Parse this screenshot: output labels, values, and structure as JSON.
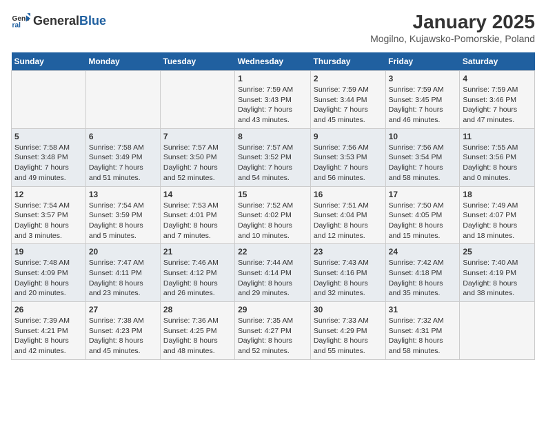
{
  "logo": {
    "text_general": "General",
    "text_blue": "Blue"
  },
  "title": "January 2025",
  "subtitle": "Mogilno, Kujawsko-Pomorskie, Poland",
  "days_of_week": [
    "Sunday",
    "Monday",
    "Tuesday",
    "Wednesday",
    "Thursday",
    "Friday",
    "Saturday"
  ],
  "weeks": [
    [
      {
        "day": "",
        "info": ""
      },
      {
        "day": "",
        "info": ""
      },
      {
        "day": "",
        "info": ""
      },
      {
        "day": "1",
        "info": "Sunrise: 7:59 AM\nSunset: 3:43 PM\nDaylight: 7 hours\nand 43 minutes."
      },
      {
        "day": "2",
        "info": "Sunrise: 7:59 AM\nSunset: 3:44 PM\nDaylight: 7 hours\nand 45 minutes."
      },
      {
        "day": "3",
        "info": "Sunrise: 7:59 AM\nSunset: 3:45 PM\nDaylight: 7 hours\nand 46 minutes."
      },
      {
        "day": "4",
        "info": "Sunrise: 7:59 AM\nSunset: 3:46 PM\nDaylight: 7 hours\nand 47 minutes."
      }
    ],
    [
      {
        "day": "5",
        "info": "Sunrise: 7:58 AM\nSunset: 3:48 PM\nDaylight: 7 hours\nand 49 minutes."
      },
      {
        "day": "6",
        "info": "Sunrise: 7:58 AM\nSunset: 3:49 PM\nDaylight: 7 hours\nand 51 minutes."
      },
      {
        "day": "7",
        "info": "Sunrise: 7:57 AM\nSunset: 3:50 PM\nDaylight: 7 hours\nand 52 minutes."
      },
      {
        "day": "8",
        "info": "Sunrise: 7:57 AM\nSunset: 3:52 PM\nDaylight: 7 hours\nand 54 minutes."
      },
      {
        "day": "9",
        "info": "Sunrise: 7:56 AM\nSunset: 3:53 PM\nDaylight: 7 hours\nand 56 minutes."
      },
      {
        "day": "10",
        "info": "Sunrise: 7:56 AM\nSunset: 3:54 PM\nDaylight: 7 hours\nand 58 minutes."
      },
      {
        "day": "11",
        "info": "Sunrise: 7:55 AM\nSunset: 3:56 PM\nDaylight: 8 hours\nand 0 minutes."
      }
    ],
    [
      {
        "day": "12",
        "info": "Sunrise: 7:54 AM\nSunset: 3:57 PM\nDaylight: 8 hours\nand 3 minutes."
      },
      {
        "day": "13",
        "info": "Sunrise: 7:54 AM\nSunset: 3:59 PM\nDaylight: 8 hours\nand 5 minutes."
      },
      {
        "day": "14",
        "info": "Sunrise: 7:53 AM\nSunset: 4:01 PM\nDaylight: 8 hours\nand 7 minutes."
      },
      {
        "day": "15",
        "info": "Sunrise: 7:52 AM\nSunset: 4:02 PM\nDaylight: 8 hours\nand 10 minutes."
      },
      {
        "day": "16",
        "info": "Sunrise: 7:51 AM\nSunset: 4:04 PM\nDaylight: 8 hours\nand 12 minutes."
      },
      {
        "day": "17",
        "info": "Sunrise: 7:50 AM\nSunset: 4:05 PM\nDaylight: 8 hours\nand 15 minutes."
      },
      {
        "day": "18",
        "info": "Sunrise: 7:49 AM\nSunset: 4:07 PM\nDaylight: 8 hours\nand 18 minutes."
      }
    ],
    [
      {
        "day": "19",
        "info": "Sunrise: 7:48 AM\nSunset: 4:09 PM\nDaylight: 8 hours\nand 20 minutes."
      },
      {
        "day": "20",
        "info": "Sunrise: 7:47 AM\nSunset: 4:11 PM\nDaylight: 8 hours\nand 23 minutes."
      },
      {
        "day": "21",
        "info": "Sunrise: 7:46 AM\nSunset: 4:12 PM\nDaylight: 8 hours\nand 26 minutes."
      },
      {
        "day": "22",
        "info": "Sunrise: 7:44 AM\nSunset: 4:14 PM\nDaylight: 8 hours\nand 29 minutes."
      },
      {
        "day": "23",
        "info": "Sunrise: 7:43 AM\nSunset: 4:16 PM\nDaylight: 8 hours\nand 32 minutes."
      },
      {
        "day": "24",
        "info": "Sunrise: 7:42 AM\nSunset: 4:18 PM\nDaylight: 8 hours\nand 35 minutes."
      },
      {
        "day": "25",
        "info": "Sunrise: 7:40 AM\nSunset: 4:19 PM\nDaylight: 8 hours\nand 38 minutes."
      }
    ],
    [
      {
        "day": "26",
        "info": "Sunrise: 7:39 AM\nSunset: 4:21 PM\nDaylight: 8 hours\nand 42 minutes."
      },
      {
        "day": "27",
        "info": "Sunrise: 7:38 AM\nSunset: 4:23 PM\nDaylight: 8 hours\nand 45 minutes."
      },
      {
        "day": "28",
        "info": "Sunrise: 7:36 AM\nSunset: 4:25 PM\nDaylight: 8 hours\nand 48 minutes."
      },
      {
        "day": "29",
        "info": "Sunrise: 7:35 AM\nSunset: 4:27 PM\nDaylight: 8 hours\nand 52 minutes."
      },
      {
        "day": "30",
        "info": "Sunrise: 7:33 AM\nSunset: 4:29 PM\nDaylight: 8 hours\nand 55 minutes."
      },
      {
        "day": "31",
        "info": "Sunrise: 7:32 AM\nSunset: 4:31 PM\nDaylight: 8 hours\nand 58 minutes."
      },
      {
        "day": "",
        "info": ""
      }
    ]
  ]
}
